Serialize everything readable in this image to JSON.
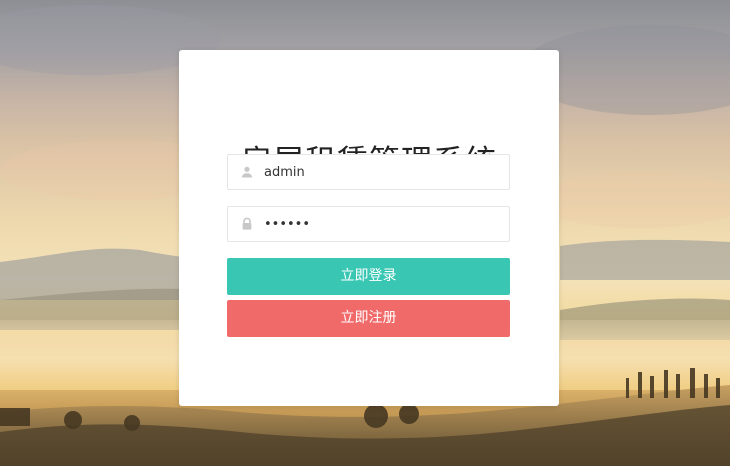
{
  "page": {
    "title": "房屋租赁管理系统"
  },
  "login_form": {
    "username_value": "admin",
    "password_value": "••••••",
    "login_button": "立即登录",
    "register_button": "立即注册"
  },
  "icons": {
    "user": "user-icon",
    "lock": "lock-icon"
  },
  "colors": {
    "login_button": "#39c7b3",
    "register_button": "#f16a6a",
    "card_background": "#ffffff"
  }
}
